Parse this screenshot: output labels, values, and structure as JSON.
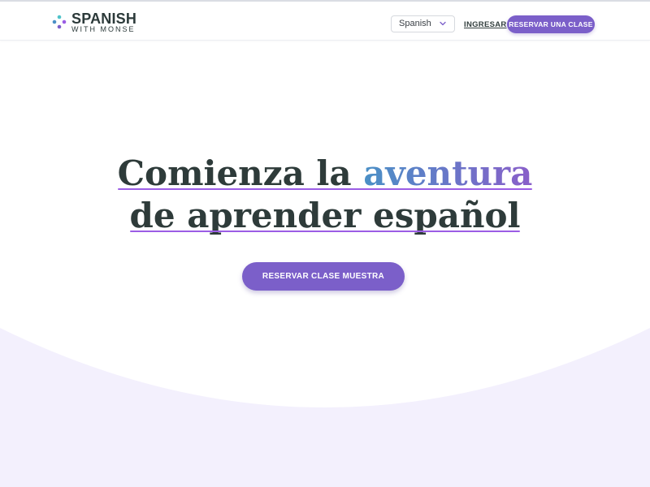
{
  "header": {
    "logo": {
      "name": "SPANISH",
      "tagline": "WITH MONSE"
    },
    "language_select": {
      "selected": "Spanish"
    },
    "login_label": "INGRESAR",
    "book_button_label": "RESERVAR UNA CLASE"
  },
  "hero": {
    "title_line1_prefix": "Comienza la ",
    "title_line1_accent": "aventura",
    "title_line2": "de aprender español",
    "cta_label": "RESERVAR CLASE MUESTRA"
  },
  "colors": {
    "accent": "#7b5fc9",
    "title_text": "#2e3b3a",
    "underline": "#9b5de5",
    "wave": "#f3f0fd"
  },
  "icons": {
    "logo_mark": "dots-cross-logo",
    "language_chevron": "chevron-down-icon"
  }
}
